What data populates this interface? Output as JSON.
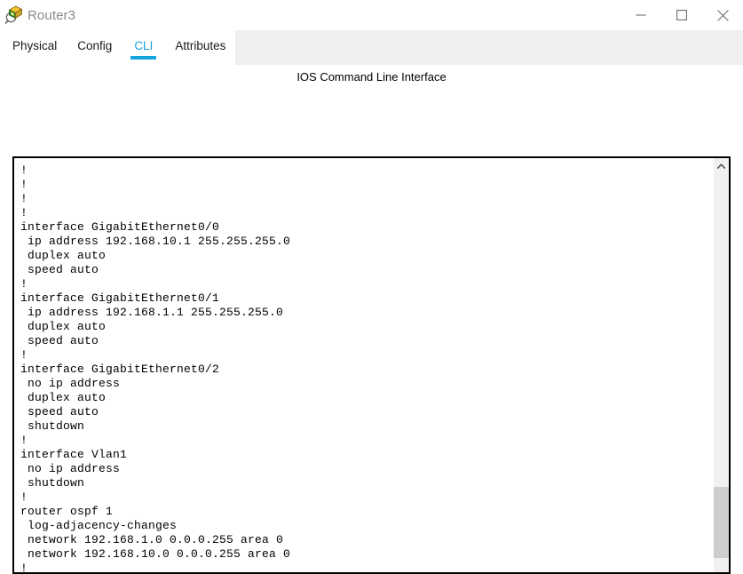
{
  "window": {
    "title": "Router3",
    "icon": "packet-tracer-device-icon",
    "controls": {
      "minimize": "minimize-icon",
      "maximize": "maximize-icon",
      "close": "close-icon"
    }
  },
  "tabs": [
    {
      "label": "Physical",
      "active": false
    },
    {
      "label": "Config",
      "active": false
    },
    {
      "label": "CLI",
      "active": true
    },
    {
      "label": "Attributes",
      "active": false
    }
  ],
  "main": {
    "heading": "IOS Command Line Interface"
  },
  "terminal": {
    "lines": [
      "!",
      "!",
      "!",
      "!",
      "interface GigabitEthernet0/0",
      " ip address 192.168.10.1 255.255.255.0",
      " duplex auto",
      " speed auto",
      "!",
      "interface GigabitEthernet0/1",
      " ip address 192.168.1.1 255.255.255.0",
      " duplex auto",
      " speed auto",
      "!",
      "interface GigabitEthernet0/2",
      " no ip address",
      " duplex auto",
      " speed auto",
      " shutdown",
      "!",
      "interface Vlan1",
      " no ip address",
      " shutdown",
      "!",
      "router ospf 1",
      " log-adjacency-changes",
      " network 192.168.1.0 0.0.0.255 area 0",
      " network 192.168.10.0 0.0.0.255 area 0",
      "!"
    ]
  },
  "scrollbar": {
    "up_arrow": "chevron-up-icon"
  },
  "colors": {
    "accent": "#17A3DE",
    "title_text": "#8a8a8a",
    "tab_strip_bg": "#efefef",
    "terminal_border": "#000000",
    "scrollbar_thumb": "#cdcdcd"
  }
}
